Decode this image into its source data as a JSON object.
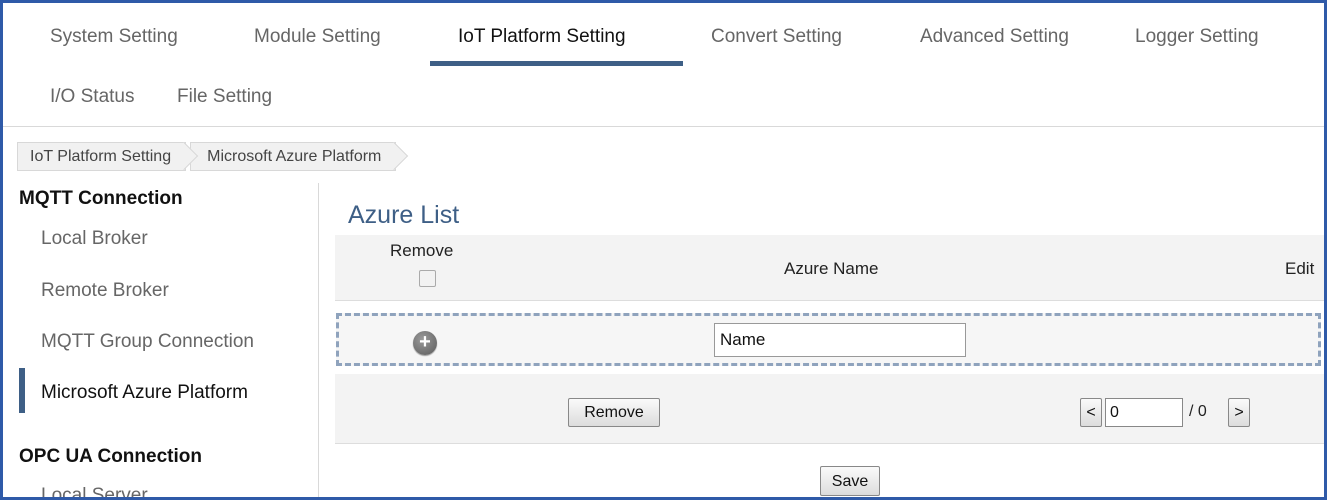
{
  "nav": {
    "tabs": [
      "System Setting",
      "Module Setting",
      "IoT Platform Setting",
      "Convert Setting",
      "Advanced Setting",
      "Logger Setting"
    ],
    "tabs_row2": [
      "I/O Status",
      "File Setting"
    ],
    "active_tab": "IoT Platform Setting"
  },
  "breadcrumb": [
    "IoT Platform Setting",
    "Microsoft Azure Platform"
  ],
  "sidebar": {
    "mqtt_heading": "MQTT Connection",
    "mqtt_items": [
      "Local Broker",
      "Remote Broker",
      "MQTT Group Connection",
      "Microsoft Azure Platform"
    ],
    "active_item": "Microsoft Azure Platform",
    "opcua_heading": "OPC UA Connection",
    "opcua_items": [
      "Local Server"
    ]
  },
  "main": {
    "title": "Azure List",
    "columns": {
      "remove": "Remove",
      "name": "Azure Name",
      "edit": "Edit"
    },
    "new_row": {
      "name_value": "Name"
    },
    "remove_button": "Remove",
    "pager": {
      "prev": "<",
      "next": ">",
      "page_value": "0",
      "total": "/ 0"
    },
    "save_button": "Save"
  },
  "colors": {
    "accent": "#3e5f86",
    "frame": "#2f5aa8",
    "dashed": "#8fa3bd"
  }
}
